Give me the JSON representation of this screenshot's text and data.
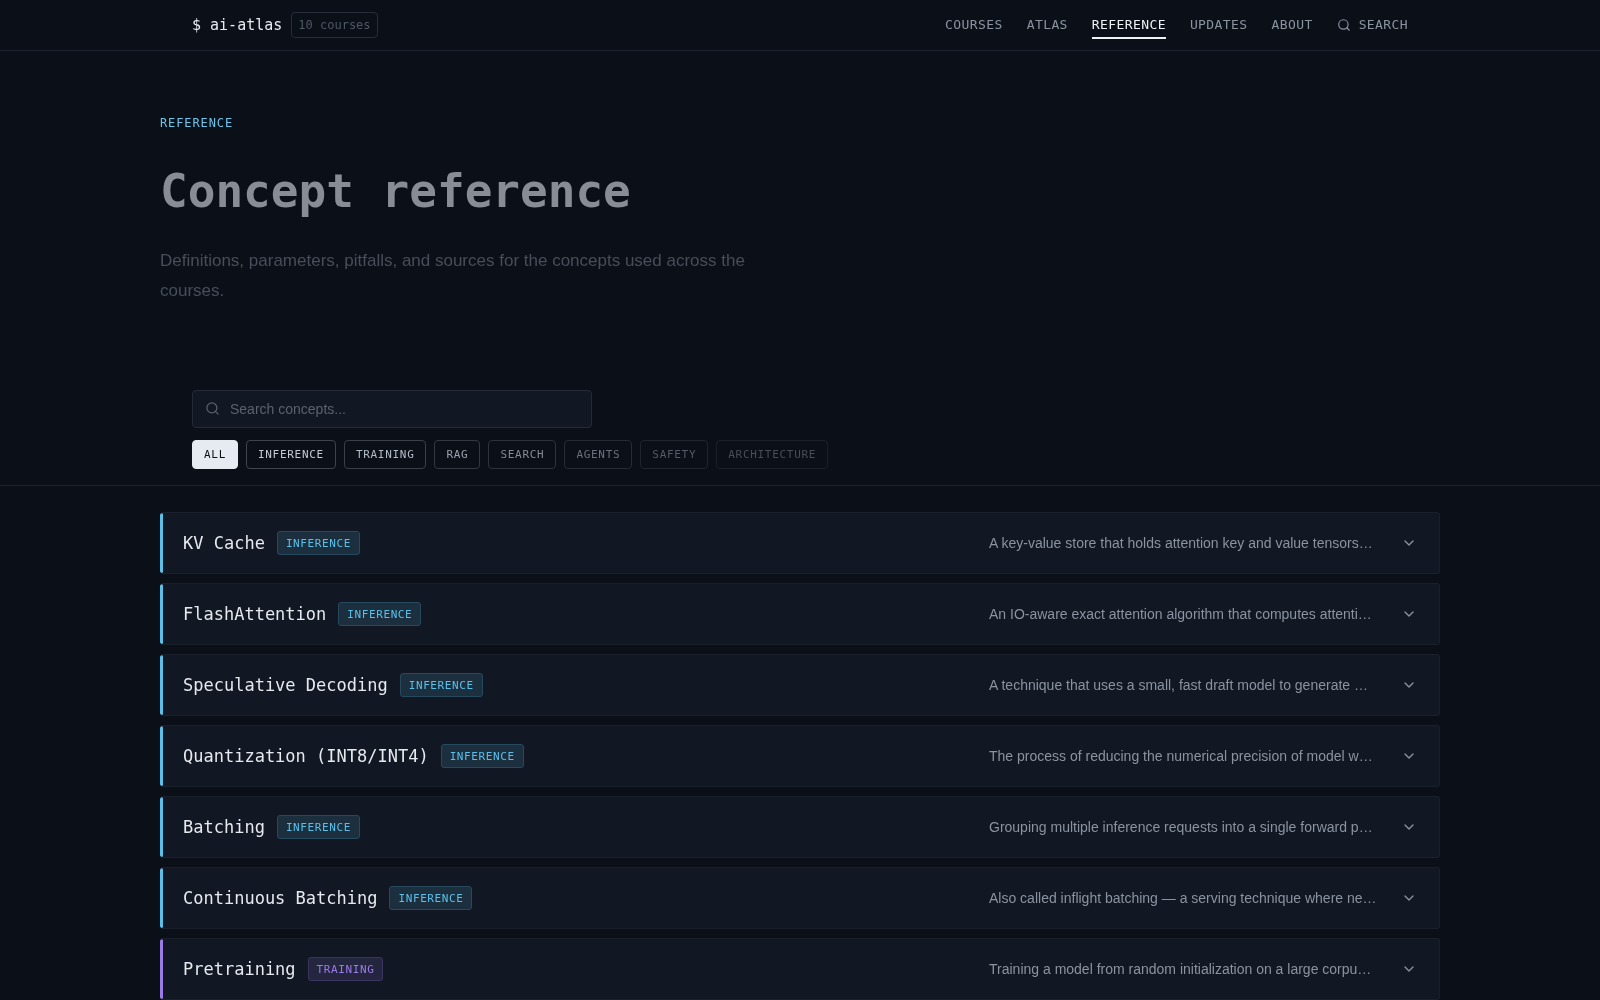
{
  "header": {
    "logo": "$ ai-atlas",
    "course_count": "10 courses",
    "nav": [
      {
        "label": "COURSES",
        "selected": false
      },
      {
        "label": "ATLAS",
        "selected": false
      },
      {
        "label": "REFERENCE",
        "selected": true
      },
      {
        "label": "UPDATES",
        "selected": false
      },
      {
        "label": "ABOUT",
        "selected": false
      }
    ],
    "search": {
      "label": "SEARCH"
    }
  },
  "hero": {
    "eyebrow": "REFERENCE",
    "title": "Concept reference",
    "description": "Definitions, parameters, pitfalls, and sources for the concepts used across the courses."
  },
  "search": {
    "placeholder": "Search concepts..."
  },
  "filters": [
    {
      "label": "ALL",
      "selected": true,
      "color": "#e6ebf2"
    },
    {
      "label": "INFERENCE",
      "selected": false,
      "color": "#c3cad4"
    },
    {
      "label": "TRAINING",
      "selected": false,
      "color": "#b3bbc6"
    },
    {
      "label": "RAG",
      "selected": false,
      "color": "#9aa2ad"
    },
    {
      "label": "SEARCH",
      "selected": false,
      "color": "#838b96"
    },
    {
      "label": "AGENTS",
      "selected": false,
      "color": "#6a727d"
    },
    {
      "label": "SAFETY",
      "selected": false,
      "color": "#545b66"
    },
    {
      "label": "ARCHITECTURE",
      "selected": false,
      "color": "#474e58"
    }
  ],
  "concepts": [
    {
      "title": "KV Cache",
      "tag": "INFERENCE",
      "color": "#5bbfe8",
      "summary": "A key-value store that holds attention key and value tensors…",
      "expanded": false
    },
    {
      "title": "FlashAttention",
      "tag": "INFERENCE",
      "color": "#5bbfe8",
      "summary": "An IO-aware exact attention algorithm that computes attenti…",
      "expanded": false
    },
    {
      "title": "Speculative Decoding",
      "tag": "INFERENCE",
      "color": "#5bbfe8",
      "summary": "A technique that uses a small, fast draft model to generate …",
      "expanded": false
    },
    {
      "title": "Quantization (INT8/INT4)",
      "tag": "INFERENCE",
      "color": "#5bbfe8",
      "summary": "The process of reducing the numerical precision of model w…",
      "expanded": false
    },
    {
      "title": "Batching",
      "tag": "INFERENCE",
      "color": "#5bbfe8",
      "summary": "Grouping multiple inference requests into a single forward p…",
      "expanded": false
    },
    {
      "title": "Continuous Batching",
      "tag": "INFERENCE",
      "color": "#5bbfe8",
      "summary": "Also called inflight batching — a serving technique where ne…",
      "expanded": false
    },
    {
      "title": "Pretraining",
      "tag": "TRAINING",
      "color": "#9b7be8",
      "summary": "Training a model from random initialization on a large corpu…",
      "expanded": false
    }
  ]
}
